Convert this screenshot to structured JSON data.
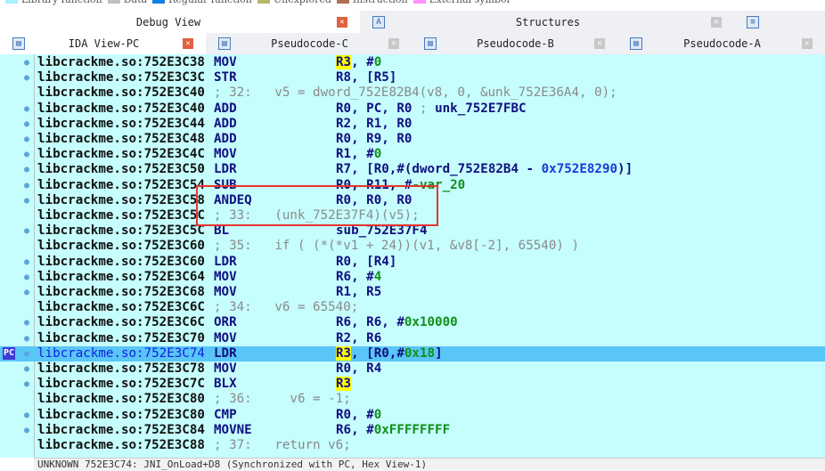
{
  "legend": [
    {
      "label": "Library function",
      "color": "#a8f0ff"
    },
    {
      "label": "Data",
      "color": "#c0c0c0"
    },
    {
      "label": "Regular function",
      "color": "#1080e0"
    },
    {
      "label": "Unexplored",
      "color": "#b8b868"
    },
    {
      "label": "Instruction",
      "color": "#b07050"
    },
    {
      "label": "External symbol",
      "color": "#ff90ff"
    }
  ],
  "tabs_top": [
    {
      "label": "Debug View",
      "active": true
    },
    {
      "label": "Structures",
      "active": false
    }
  ],
  "tabs": [
    {
      "label": "IDA View-PC",
      "active": true
    },
    {
      "label": "Pseudocode-C",
      "active": false
    },
    {
      "label": "Pseudocode-B",
      "active": false
    },
    {
      "label": "Pseudocode-A",
      "active": false
    }
  ],
  "pc_marker": "PC",
  "lines": [
    {
      "dot": true,
      "addr": "libcrackme.so:752E3C38",
      "mn": "MOV",
      "ops": [
        [
          "R3",
          "hl"
        ],
        [
          ", #",
          ""
        ],
        [
          "0",
          "num"
        ]
      ]
    },
    {
      "dot": true,
      "addr": "libcrackme.so:752E3C3C",
      "mn": "STR",
      "ops": [
        [
          "R8, [R5]",
          ""
        ]
      ]
    },
    {
      "dot": false,
      "addr": "libcrackme.so:752E3C40",
      "comment": "; 32:   v5 = dword_752E82B4(v8, 0, &unk_752E36A4, 0);"
    },
    {
      "dot": true,
      "addr": "libcrackme.so:752E3C40",
      "mn": "ADD",
      "ops": [
        [
          "R0, PC, R0 ",
          ""
        ],
        [
          "; ",
          "cm"
        ],
        [
          "unk_752E7FBC",
          "sym"
        ]
      ]
    },
    {
      "dot": true,
      "addr": "libcrackme.so:752E3C44",
      "mn": "ADD",
      "ops": [
        [
          "R2, R1, R0",
          ""
        ]
      ]
    },
    {
      "dot": true,
      "addr": "libcrackme.so:752E3C48",
      "mn": "ADD",
      "ops": [
        [
          "R0, R9, R0",
          ""
        ]
      ]
    },
    {
      "dot": true,
      "addr": "libcrackme.so:752E3C4C",
      "mn": "MOV",
      "ops": [
        [
          "R1, #",
          ""
        ],
        [
          "0",
          "num"
        ]
      ]
    },
    {
      "dot": true,
      "addr": "libcrackme.so:752E3C50",
      "mn": "LDR",
      "ops": [
        [
          "R7, [R0,#(dword_752E82B4 - ",
          ""
        ],
        [
          "0x752E8290",
          "hex"
        ],
        [
          ")]",
          ""
        ]
      ]
    },
    {
      "dot": true,
      "addr": "libcrackme.so:752E3C54",
      "mn": "SUB",
      "ops": [
        [
          "R0, R11, #",
          ""
        ],
        [
          "-var_20",
          "num"
        ]
      ]
    },
    {
      "dot": true,
      "addr": "libcrackme.so:752E3C58",
      "mn": "ANDEQ",
      "ops": [
        [
          "R0, R0, R0",
          ""
        ]
      ]
    },
    {
      "dot": false,
      "addr": "libcrackme.so:752E3C5C",
      "comment": "; 33:   (unk_752E37F4)(v5);"
    },
    {
      "dot": true,
      "addr": "libcrackme.so:752E3C5C",
      "mn": "BL",
      "ops": [
        [
          "sub_752E37F4",
          ""
        ]
      ]
    },
    {
      "dot": false,
      "addr": "libcrackme.so:752E3C60",
      "comment": "; 35:   if ( (*(*v1 + 24))(v1, &v8[-2], 65540) )"
    },
    {
      "dot": true,
      "addr": "libcrackme.so:752E3C60",
      "mn": "LDR",
      "ops": [
        [
          "R0, [R4]",
          ""
        ]
      ]
    },
    {
      "dot": true,
      "addr": "libcrackme.so:752E3C64",
      "mn": "MOV",
      "ops": [
        [
          "R6, #",
          ""
        ],
        [
          "4",
          "num"
        ]
      ]
    },
    {
      "dot": true,
      "addr": "libcrackme.so:752E3C68",
      "mn": "MOV",
      "ops": [
        [
          "R1, R5",
          ""
        ]
      ]
    },
    {
      "dot": false,
      "addr": "libcrackme.so:752E3C6C",
      "comment": "; 34:   v6 = 65540;"
    },
    {
      "dot": true,
      "addr": "libcrackme.so:752E3C6C",
      "mn": "ORR",
      "ops": [
        [
          "R6, R6, #",
          ""
        ],
        [
          "0x10000",
          "num"
        ]
      ]
    },
    {
      "dot": true,
      "addr": "libcrackme.so:752E3C70",
      "mn": "MOV",
      "ops": [
        [
          "R2, R6",
          ""
        ]
      ]
    },
    {
      "dot": true,
      "pc": true,
      "addr": "libcrackme.so:752E3C74",
      "mn": "LDR",
      "ops": [
        [
          "R3",
          "hl"
        ],
        [
          ", [R0,#",
          ""
        ],
        [
          "0x18",
          "num"
        ],
        [
          "]",
          ""
        ]
      ]
    },
    {
      "dot": true,
      "addr": "libcrackme.so:752E3C78",
      "mn": "MOV",
      "ops": [
        [
          "R0, R4",
          ""
        ]
      ]
    },
    {
      "dot": true,
      "addr": "libcrackme.so:752E3C7C",
      "mn": "BLX",
      "ops": [
        [
          "R3",
          "hl"
        ]
      ]
    },
    {
      "dot": false,
      "addr": "libcrackme.so:752E3C80",
      "comment": "; 36:     v6 = -1;"
    },
    {
      "dot": true,
      "addr": "libcrackme.so:752E3C80",
      "mn": "CMP",
      "ops": [
        [
          "R0, #",
          ""
        ],
        [
          "0",
          "num"
        ]
      ]
    },
    {
      "dot": true,
      "addr": "libcrackme.so:752E3C84",
      "mn": "MOVNE",
      "ops": [
        [
          "R6, #",
          ""
        ],
        [
          "0xFFFFFFFF",
          "num"
        ]
      ]
    },
    {
      "dot": false,
      "addr": "libcrackme.so:752E3C88",
      "comment": "; 37:   return v6;"
    }
  ],
  "status": "UNKNOWN 752E3C74: JNI_OnLoad+D8 (Synchronized with PC, Hex View-1)"
}
